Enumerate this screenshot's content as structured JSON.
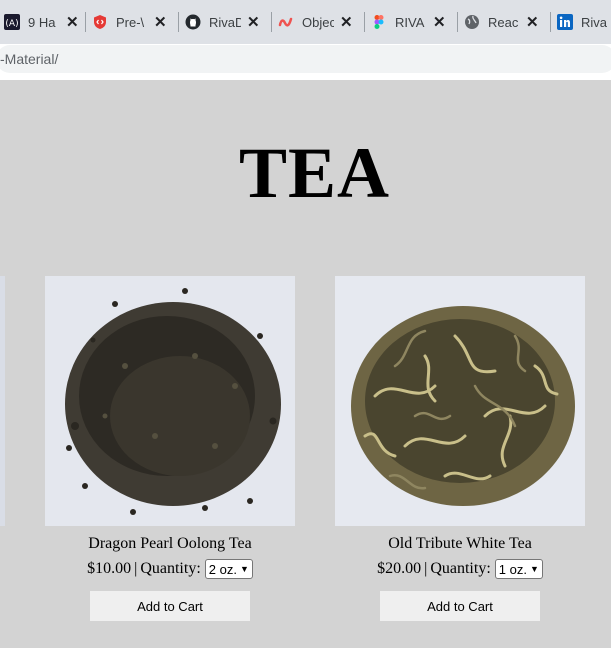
{
  "tabs": [
    {
      "title": "9 Ha",
      "icon": "angular-icon"
    },
    {
      "title": "Pre-\\",
      "icon": "shield-code-icon"
    },
    {
      "title": "RivaD",
      "icon": "github-icon"
    },
    {
      "title": "Objec",
      "icon": "tilde-logo-icon"
    },
    {
      "title": "RIVA",
      "icon": "figma-icon"
    },
    {
      "title": "Reac",
      "icon": "globe-icon"
    },
    {
      "title": "Riva",
      "icon": "linkedin-icon"
    }
  ],
  "tab_close_glyph": "✕",
  "address": {
    "url": "-Material/"
  },
  "page": {
    "heading": "TEA"
  },
  "products": [
    {
      "name": "Dragon Pearl Oolong Tea",
      "price": "$10.00",
      "separator": "|",
      "quantity_label": "Quantity:",
      "quantity_selected": "2 oz.",
      "button": "Add to Cart"
    },
    {
      "name": "Old Tribute White Tea",
      "price": "$20.00",
      "separator": "|",
      "quantity_label": "Quantity:",
      "quantity_selected": "1 oz.",
      "button": "Add to Cart"
    }
  ],
  "colors": {
    "page_bg": "#d3d3d3",
    "tab_bar": "#dee1e6",
    "button_bg": "#efefef"
  }
}
